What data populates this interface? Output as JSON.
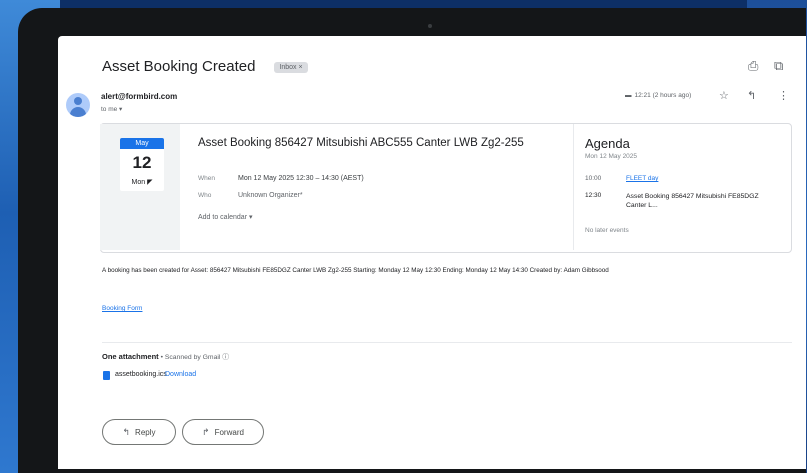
{
  "email": {
    "subject": "Asset Booking Created",
    "label_chip": "Inbox ×",
    "top_icons": {
      "print": "printer-icon",
      "open": "open-in-new-icon"
    },
    "sender": "alert@formbird.com",
    "to_line": "to me ▾",
    "time": "12:21 (2 hours ago)",
    "header_icons": {
      "star": "star-icon",
      "reply": "reply-icon",
      "more": "more-vert-icon"
    }
  },
  "invite": {
    "month": "May",
    "day": "12",
    "weekday": "Mon",
    "title": "Asset Booking 856427 Mitsubishi  ABC555 Canter LWB Zg2-255",
    "when_label": "When",
    "when_value": "Mon 12 May 2025 12:30 – 14:30 (AEST)",
    "who_label": "Who",
    "who_value": "Unknown Organizer*",
    "add_calendar": "Add to calendar ▾"
  },
  "agenda": {
    "title": "Agenda",
    "date": "Mon 12 May 2025",
    "items": [
      {
        "time": "10:00",
        "text": "FLEET day"
      },
      {
        "time": "12:30",
        "text": "Asset Booking 856427 Mitsubishi FE85DGZ Canter L..."
      }
    ],
    "footer": "No later events"
  },
  "body": {
    "text": "A booking has been created for Asset: 856427 Mitsubishi FE85DGZ Canter LWB Zg2-255 Starting: Monday 12 May 12:30 Ending: Monday 12 May 14:30 Created by: Adam Gibbsood",
    "link": "Booking Form"
  },
  "attachments": {
    "title": "One attachment",
    "scan": " • Scanned by Gmail ⓘ",
    "file_name": "assetbooking.ics",
    "download": "Download"
  },
  "actions": {
    "reply": "Reply",
    "forward": "Forward"
  }
}
